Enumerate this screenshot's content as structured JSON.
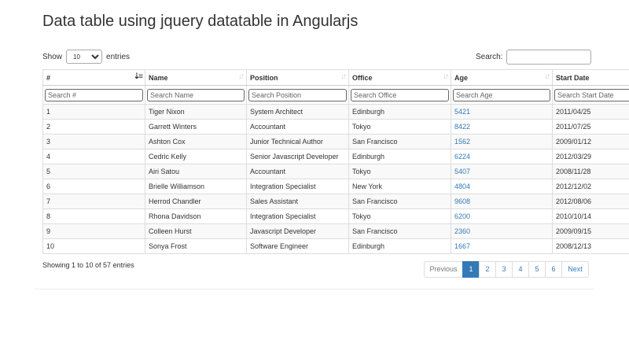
{
  "title": "Data table using jquery datatable in Angularjs",
  "length_control": {
    "prefix": "Show",
    "selected": "10",
    "suffix": "entries"
  },
  "search": {
    "label": "Search:",
    "value": ""
  },
  "columns": [
    {
      "label": "#",
      "placeholder": "Search #"
    },
    {
      "label": "Name",
      "placeholder": "Search Name"
    },
    {
      "label": "Position",
      "placeholder": "Search Position"
    },
    {
      "label": "Office",
      "placeholder": "Search Office"
    },
    {
      "label": "Age",
      "placeholder": "Search Age"
    },
    {
      "label": "Start Date",
      "placeholder": "Search Start Date"
    }
  ],
  "rows": [
    [
      "1",
      "Tiger Nixon",
      "System Architect",
      "Edinburgh",
      "5421",
      "2011/04/25"
    ],
    [
      "2",
      "Garrett Winters",
      "Accountant",
      "Tokyo",
      "8422",
      "2011/07/25"
    ],
    [
      "3",
      "Ashton Cox",
      "Junior Technical Author",
      "San Francisco",
      "1562",
      "2009/01/12"
    ],
    [
      "4",
      "Cedric Kelly",
      "Senior Javascript Developer",
      "Edinburgh",
      "6224",
      "2012/03/29"
    ],
    [
      "5",
      "Airi Satou",
      "Accountant",
      "Tokyo",
      "5407",
      "2008/11/28"
    ],
    [
      "6",
      "Brielle Williamson",
      "Integration Specialist",
      "New York",
      "4804",
      "2012/12/02"
    ],
    [
      "7",
      "Herrod Chandler",
      "Sales Assistant",
      "San Francisco",
      "9608",
      "2012/08/06"
    ],
    [
      "8",
      "Rhona Davidson",
      "Integration Specialist",
      "Tokyo",
      "6200",
      "2010/10/14"
    ],
    [
      "9",
      "Colleen Hurst",
      "Javascript Developer",
      "San Francisco",
      "2360",
      "2009/09/15"
    ],
    [
      "10",
      "Sonya Frost",
      "Software Engineer",
      "Edinburgh",
      "1667",
      "2008/12/13"
    ]
  ],
  "info": "Showing 1 to 10 of 57 entries",
  "pagination": {
    "previous": "Previous",
    "pages": [
      "1",
      "2",
      "3",
      "4",
      "5",
      "6"
    ],
    "active": "1",
    "next": "Next"
  },
  "colors": {
    "link": "#337ab7",
    "active_page_bg": "#337ab7",
    "stripe": "#f9f9f9"
  },
  "icons": {
    "sort_active": "sort-ascending-icon",
    "sort_inactive": "sort-both-icon"
  }
}
